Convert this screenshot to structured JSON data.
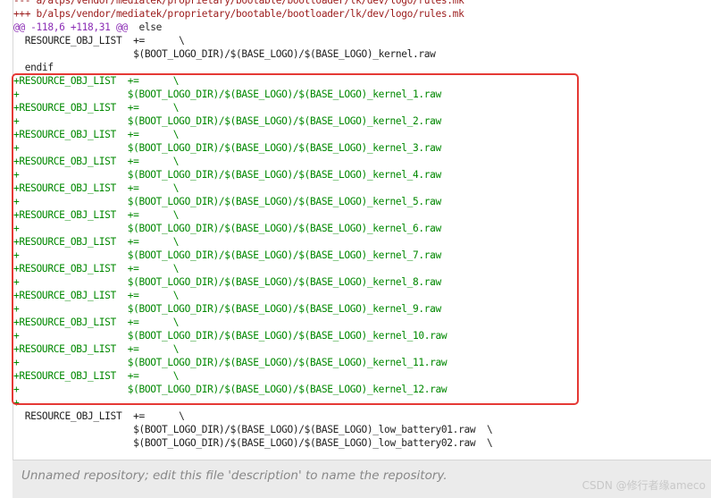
{
  "diff": {
    "header_lines": [
      "--- a/alps/vendor/mediatek/proprietary/bootable/bootloader/lk/dev/logo/rules.mk",
      "+++ b/alps/vendor/mediatek/proprietary/bootable/bootloader/lk/dev/logo/rules.mk"
    ],
    "hunk": {
      "range": "@@ -118,6 +118,31 @@",
      "context": "  else"
    },
    "context_before": [
      "  RESOURCE_OBJ_LIST  +=      \\",
      "                     $(BOOT_LOGO_DIR)/$(BASE_LOGO)/$(BASE_LOGO)_kernel.raw",
      "  endif"
    ],
    "added_lines": [
      "+RESOURCE_OBJ_LIST  +=      \\",
      "+                   $(BOOT_LOGO_DIR)/$(BASE_LOGO)/$(BASE_LOGO)_kernel_1.raw",
      "+RESOURCE_OBJ_LIST  +=      \\",
      "+                   $(BOOT_LOGO_DIR)/$(BASE_LOGO)/$(BASE_LOGO)_kernel_2.raw",
      "+RESOURCE_OBJ_LIST  +=      \\",
      "+                   $(BOOT_LOGO_DIR)/$(BASE_LOGO)/$(BASE_LOGO)_kernel_3.raw",
      "+RESOURCE_OBJ_LIST  +=      \\",
      "+                   $(BOOT_LOGO_DIR)/$(BASE_LOGO)/$(BASE_LOGO)_kernel_4.raw",
      "+RESOURCE_OBJ_LIST  +=      \\",
      "+                   $(BOOT_LOGO_DIR)/$(BASE_LOGO)/$(BASE_LOGO)_kernel_5.raw",
      "+RESOURCE_OBJ_LIST  +=      \\",
      "+                   $(BOOT_LOGO_DIR)/$(BASE_LOGO)/$(BASE_LOGO)_kernel_6.raw",
      "+RESOURCE_OBJ_LIST  +=      \\",
      "+                   $(BOOT_LOGO_DIR)/$(BASE_LOGO)/$(BASE_LOGO)_kernel_7.raw",
      "+RESOURCE_OBJ_LIST  +=      \\",
      "+                   $(BOOT_LOGO_DIR)/$(BASE_LOGO)/$(BASE_LOGO)_kernel_8.raw",
      "+RESOURCE_OBJ_LIST  +=      \\",
      "+                   $(BOOT_LOGO_DIR)/$(BASE_LOGO)/$(BASE_LOGO)_kernel_9.raw",
      "+RESOURCE_OBJ_LIST  +=      \\",
      "+                   $(BOOT_LOGO_DIR)/$(BASE_LOGO)/$(BASE_LOGO)_kernel_10.raw",
      "+RESOURCE_OBJ_LIST  +=      \\",
      "+                   $(BOOT_LOGO_DIR)/$(BASE_LOGO)/$(BASE_LOGO)_kernel_11.raw",
      "+RESOURCE_OBJ_LIST  +=      \\",
      "+                   $(BOOT_LOGO_DIR)/$(BASE_LOGO)/$(BASE_LOGO)_kernel_12.raw",
      "+"
    ],
    "context_after": [
      "  RESOURCE_OBJ_LIST  +=      \\",
      "                     $(BOOT_LOGO_DIR)/$(BASE_LOGO)/$(BASE_LOGO)_low_battery01.raw  \\",
      "                     $(BOOT_LOGO_DIR)/$(BASE_LOGO)/$(BASE_LOGO)_low_battery02.raw  \\"
    ]
  },
  "footer": {
    "description": "Unnamed repository; edit this file 'description' to name the repository."
  },
  "watermark": "CSDN @修行者缘ameco",
  "colors": {
    "added": "#008800",
    "header": "#9b1b1b",
    "hunk": "#8b2db5",
    "context": "#222222",
    "highlight": "#e53935"
  }
}
